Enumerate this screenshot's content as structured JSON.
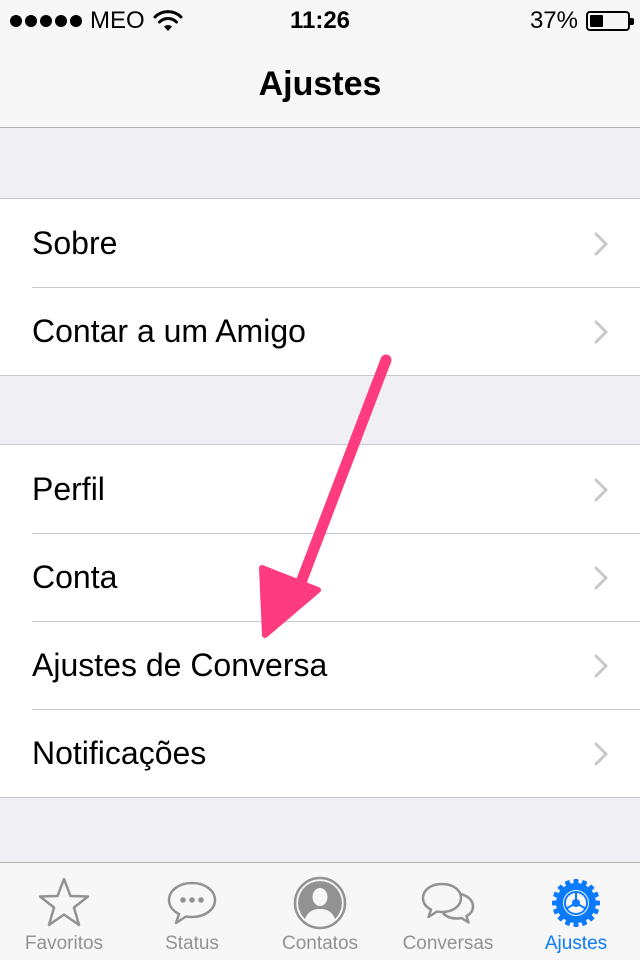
{
  "status_bar": {
    "carrier": "MEO",
    "time": "11:26",
    "battery_percent": "37%",
    "battery_level": 0.37,
    "signal_bars": 5
  },
  "nav": {
    "title": "Ajustes"
  },
  "groups": [
    {
      "items": [
        {
          "label": "Sobre"
        },
        {
          "label": "Contar a um Amigo"
        }
      ]
    },
    {
      "items": [
        {
          "label": "Perfil"
        },
        {
          "label": "Conta"
        },
        {
          "label": "Ajustes de Conversa"
        },
        {
          "label": "Notificações"
        }
      ]
    }
  ],
  "tab_bar": {
    "tabs": [
      {
        "label": "Favoritos",
        "icon": "star-icon",
        "active": false
      },
      {
        "label": "Status",
        "icon": "speech-bubble-dots-icon",
        "active": false
      },
      {
        "label": "Contatos",
        "icon": "contact-person-icon",
        "active": false
      },
      {
        "label": "Conversas",
        "icon": "two-speech-bubbles-icon",
        "active": false
      },
      {
        "label": "Ajustes",
        "icon": "gear-icon",
        "active": true
      }
    ],
    "active_color": "#0a7aff",
    "inactive_color": "#929292"
  },
  "annotation": {
    "color": "#ff3b7f",
    "points_to": "Ajustes de Conversa"
  }
}
